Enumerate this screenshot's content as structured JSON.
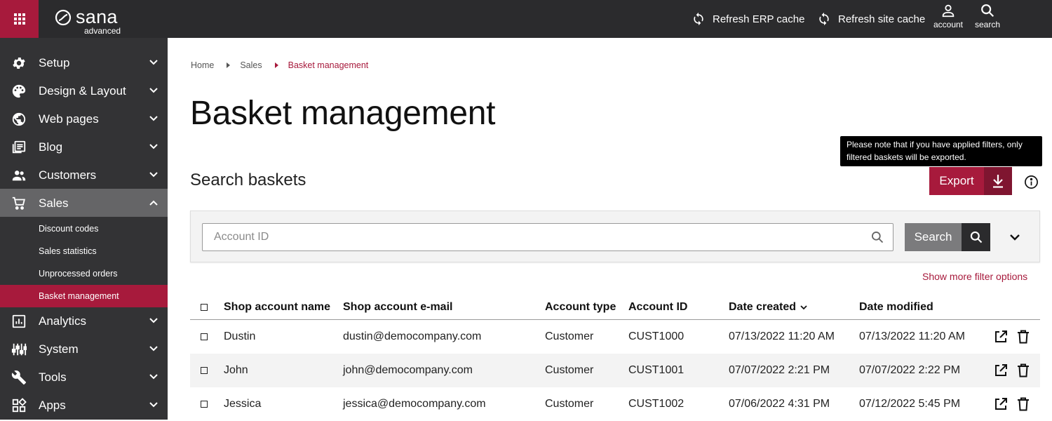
{
  "brand": {
    "name": "sana",
    "edition": "advanced",
    "accent": "#a71a3c",
    "dark": "#2b2b2d"
  },
  "topbar": {
    "refresh_erp": "Refresh ERP cache",
    "refresh_site": "Refresh site cache",
    "account": "account",
    "search": "search"
  },
  "sidebar": {
    "items": [
      {
        "label": "Setup",
        "icon": "gear-icon"
      },
      {
        "label": "Design & Layout",
        "icon": "palette-icon"
      },
      {
        "label": "Web pages",
        "icon": "globe-icon"
      },
      {
        "label": "Blog",
        "icon": "blog-icon"
      },
      {
        "label": "Customers",
        "icon": "people-icon"
      },
      {
        "label": "Sales",
        "icon": "cart-icon"
      },
      {
        "label": "Analytics",
        "icon": "analytics-icon"
      },
      {
        "label": "System",
        "icon": "sliders-icon"
      },
      {
        "label": "Tools",
        "icon": "wrench-icon"
      },
      {
        "label": "Apps",
        "icon": "apps-grid-icon"
      }
    ],
    "sales_sub": [
      "Discount codes",
      "Sales statistics",
      "Unprocessed orders",
      "Basket management"
    ]
  },
  "breadcrumb": {
    "home": "Home",
    "sales": "Sales",
    "current": "Basket management"
  },
  "page_title": "Basket management",
  "section_title": "Search baskets",
  "tooltip": "Please note that if you have applied filters, only filtered baskets will be exported.",
  "export_label": "Export",
  "search": {
    "placeholder": "Account ID",
    "button": "Search",
    "more_filters": "Show more filter options"
  },
  "table": {
    "headers": [
      "Shop account name",
      "Shop account e-mail",
      "Account type",
      "Account ID",
      "Date created",
      "Date modified"
    ],
    "rows": [
      {
        "name": "Dustin",
        "email": "dustin@democompany.com",
        "type": "Customer",
        "id": "CUST1000",
        "created": "07/13/2022 11:20 AM",
        "modified": "07/13/2022 11:20 AM"
      },
      {
        "name": "John",
        "email": "john@democompany.com",
        "type": "Customer",
        "id": "CUST1001",
        "created": "07/07/2022 2:21 PM",
        "modified": "07/07/2022 2:22 PM"
      },
      {
        "name": "Jessica",
        "email": "jessica@democompany.com",
        "type": "Customer",
        "id": "CUST1002",
        "created": "07/06/2022 4:31 PM",
        "modified": "07/12/2022 5:45 PM"
      }
    ]
  }
}
